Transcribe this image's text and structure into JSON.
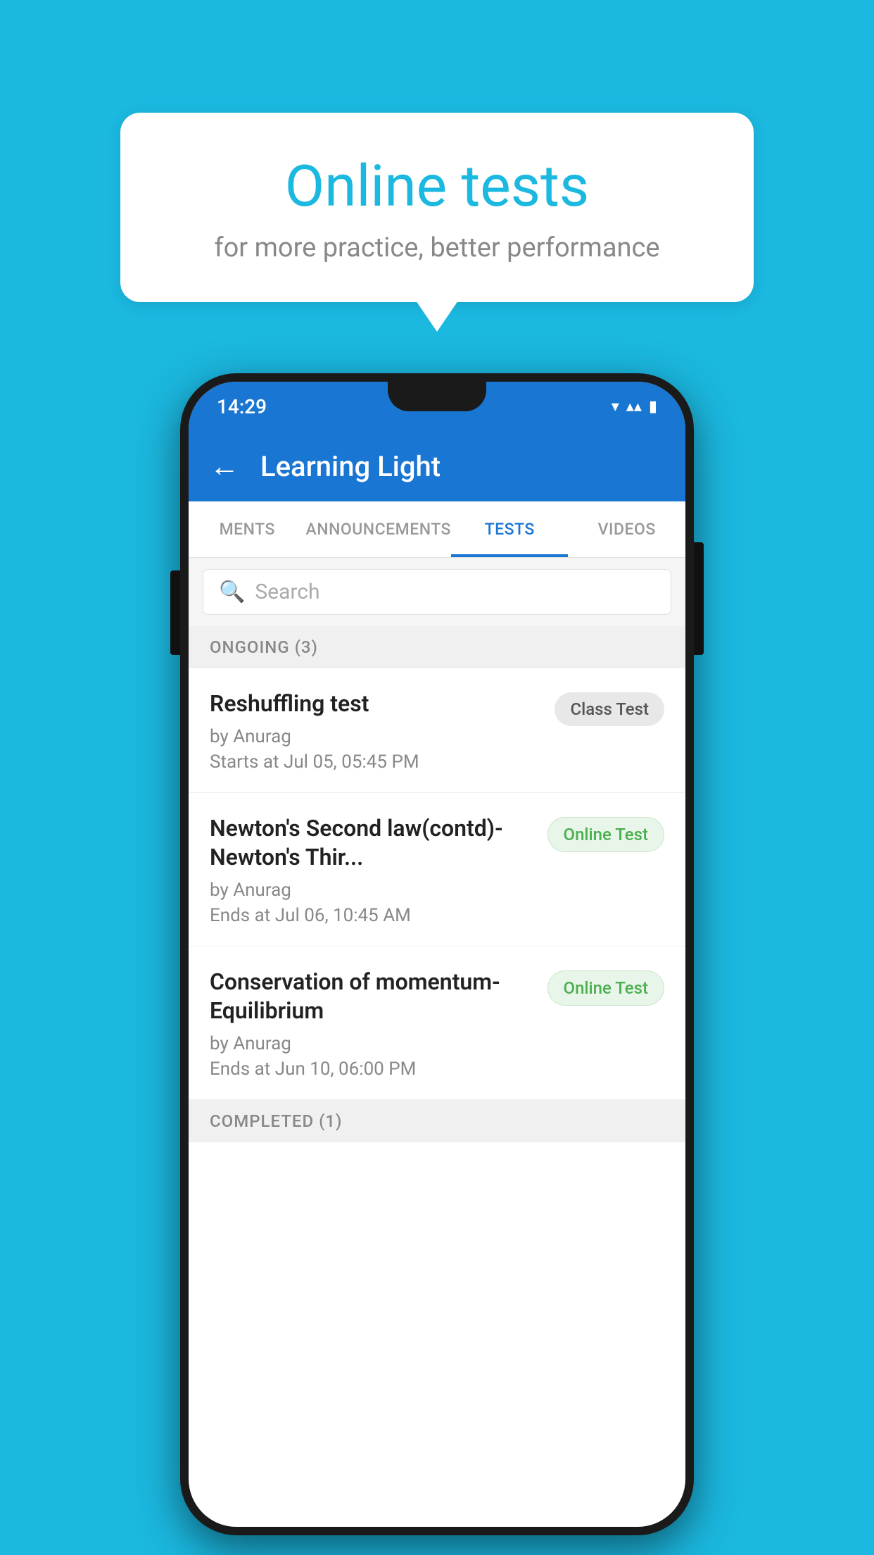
{
  "background_color": "#1BB8E0",
  "speech_bubble": {
    "title": "Online tests",
    "subtitle": "for more practice, better performance"
  },
  "phone": {
    "status_bar": {
      "time": "14:29",
      "icons": "▼◀▮"
    },
    "app_bar": {
      "back_label": "←",
      "title": "Learning Light"
    },
    "tabs": [
      {
        "label": "MENTS",
        "active": false
      },
      {
        "label": "ANNOUNCEMENTS",
        "active": false
      },
      {
        "label": "TESTS",
        "active": true
      },
      {
        "label": "VIDEOS",
        "active": false
      }
    ],
    "search": {
      "placeholder": "Search"
    },
    "sections": [
      {
        "header": "ONGOING (3)",
        "items": [
          {
            "title": "Reshuffling test",
            "author": "by Anurag",
            "date": "Starts at  Jul 05, 05:45 PM",
            "badge": "Class Test",
            "badge_type": "class"
          },
          {
            "title": "Newton's Second law(contd)-Newton's Thir...",
            "author": "by Anurag",
            "date": "Ends at  Jul 06, 10:45 AM",
            "badge": "Online Test",
            "badge_type": "online"
          },
          {
            "title": "Conservation of momentum-Equilibrium",
            "author": "by Anurag",
            "date": "Ends at  Jun 10, 06:00 PM",
            "badge": "Online Test",
            "badge_type": "online"
          }
        ]
      },
      {
        "header": "COMPLETED (1)"
      }
    ]
  }
}
